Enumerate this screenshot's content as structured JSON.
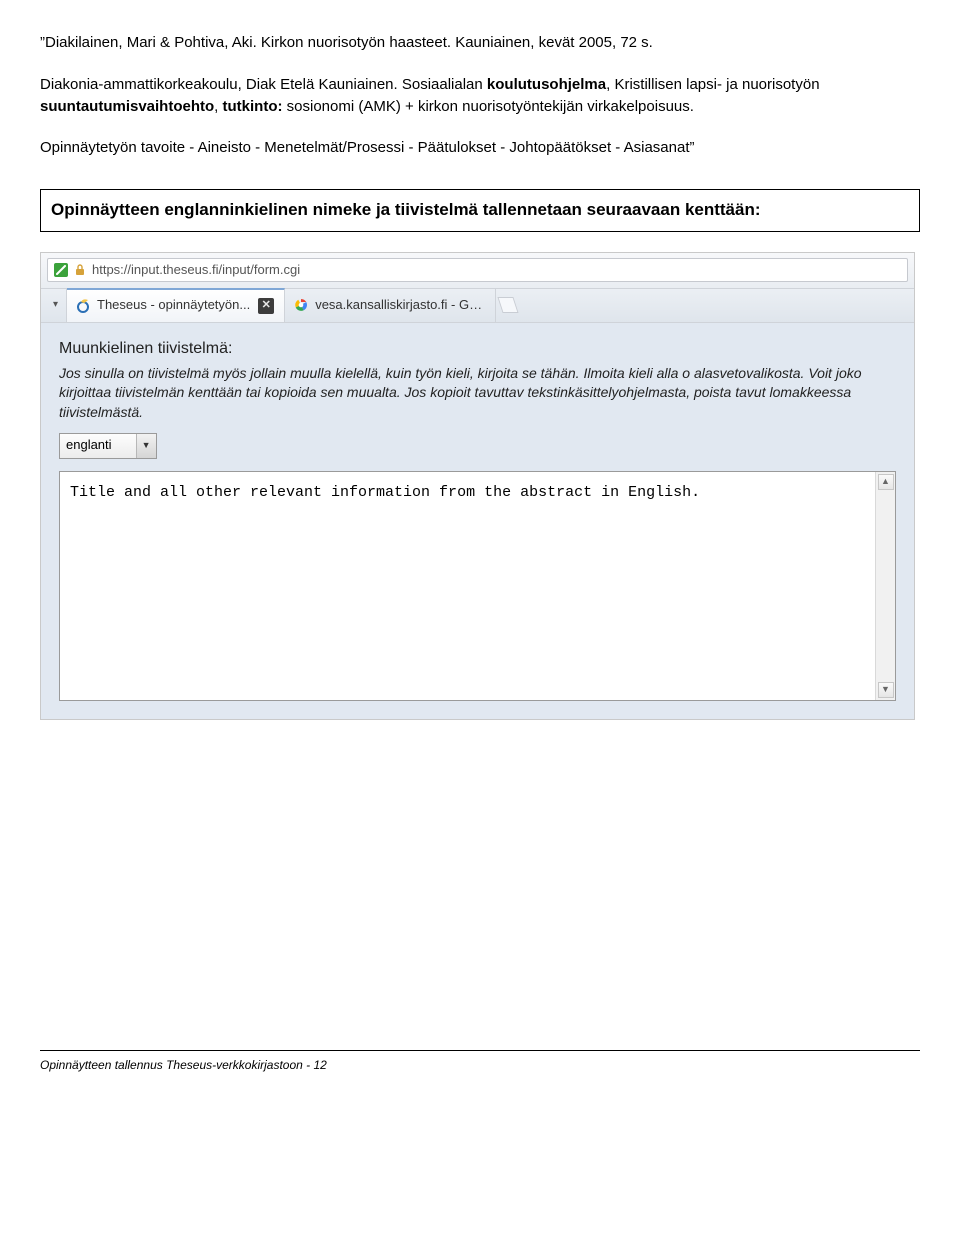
{
  "doc": {
    "p1_a": "”Diakilainen, Mari & Pohtiva, Aki. Kirkon nuorisotyön haasteet. Kauniainen, kevät 2005, 72 s.",
    "p2": "Diakonia-ammattikorkeakoulu, Diak Etelä Kauniainen. Sosiaalialan ",
    "p2_b1": "koulutusohjelma",
    "p2_mid": ", Kristillisen lapsi- ja nuorisotyön ",
    "p2_b2": "suuntautumisvaihtoehto",
    "p2_mid2": ", ",
    "p2_b3": "tutkinto:",
    "p2_end": " sosionomi (AMK) + kirkon nuorisotyöntekijän virkakelpoisuus.",
    "p3": "Opinnäytetyön tavoite - Aineisto - Menetelmät/Prosessi - Päätulokset - Johtopäätökset - Asiasanat”",
    "banner": "Opinnäytteen englanninkielinen nimeke ja tiivistelmä tallennetaan seuraavaan kenttään:"
  },
  "browser": {
    "url": "https://input.theseus.fi/input/form.cgi",
    "tabs": [
      {
        "title": "Theseus - opinnäytetyön...",
        "active": true
      },
      {
        "title": "vesa.kansalliskirjasto.fi - Go...",
        "active": false
      }
    ]
  },
  "form": {
    "heading": "Muunkielinen tiivistelmä:",
    "help": "Jos sinulla on tiivistelmä myös jollain muulla kielellä, kuin työn kieli, kirjoita se tähän. Ilmoita kieli alla o alasvetovalikosta. Voit joko kirjoittaa tiivistelmän kenttään tai kopioida sen muualta. Jos kopioit tavuttav tekstinkäsittelyohjelmasta, poista tavut lomakkeessa tiivistelmästä.",
    "select_value": "englanti",
    "textarea_value": "Title and all other relevant information from the abstract in English."
  },
  "footer": "Opinnäytteen tallennus Theseus-verkkokirjastoon  - 12"
}
